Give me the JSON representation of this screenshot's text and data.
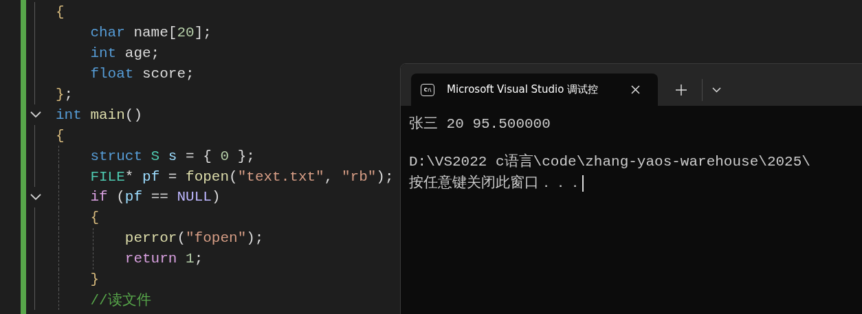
{
  "editor": {
    "lines": [
      {
        "foldable": false,
        "tokens": [
          {
            "t": "{",
            "kind": "brace"
          }
        ],
        "children": [
          {
            "foldable": false,
            "tokens": [
              {
                "t": "char",
                "kind": "keyword"
              },
              {
                "t": " name[",
                "kind": "plain"
              },
              {
                "t": "20",
                "kind": "number"
              },
              {
                "t": "];",
                "kind": "plain"
              }
            ]
          },
          {
            "foldable": false,
            "tokens": [
              {
                "t": "int",
                "kind": "keyword"
              },
              {
                "t": " age;",
                "kind": "plain"
              }
            ]
          },
          {
            "foldable": false,
            "tokens": [
              {
                "t": "float",
                "kind": "keyword"
              },
              {
                "t": " score;",
                "kind": "plain"
              }
            ]
          }
        ]
      },
      {
        "foldable": false,
        "tokens": [
          {
            "t": "}",
            "kind": "brace"
          },
          {
            "t": ";",
            "kind": "plain"
          }
        ]
      },
      {
        "foldable": true,
        "tokens": [
          {
            "t": "int",
            "kind": "keyword"
          },
          {
            "t": " main",
            "kind": "function"
          },
          {
            "t": "()",
            "kind": "plain"
          }
        ]
      },
      {
        "foldable": false,
        "tokens": [
          {
            "t": "{",
            "kind": "brace"
          }
        ],
        "children": [
          {
            "foldable": false,
            "tokens": [
              {
                "t": "struct",
                "kind": "keyword"
              },
              {
                "t": " S",
                "kind": "type"
              },
              {
                "t": " s",
                "kind": "variable"
              },
              {
                "t": " = { ",
                "kind": "plain"
              },
              {
                "t": "0",
                "kind": "number"
              },
              {
                "t": " };",
                "kind": "plain"
              }
            ]
          },
          {
            "foldable": false,
            "tokens": [
              {
                "t": "FILE",
                "kind": "type"
              },
              {
                "t": "* ",
                "kind": "plain"
              },
              {
                "t": "pf",
                "kind": "variable"
              },
              {
                "t": " = ",
                "kind": "plain"
              },
              {
                "t": "fopen",
                "kind": "function"
              },
              {
                "t": "(",
                "kind": "plain"
              },
              {
                "t": "\"text.txt\"",
                "kind": "string"
              },
              {
                "t": ", ",
                "kind": "plain"
              },
              {
                "t": "\"rb\"",
                "kind": "string"
              },
              {
                "t": ");",
                "kind": "plain"
              }
            ]
          },
          {
            "foldable": true,
            "tokens": [
              {
                "t": "if",
                "kind": "control"
              },
              {
                "t": " (",
                "kind": "plain"
              },
              {
                "t": "pf",
                "kind": "variable"
              },
              {
                "t": " == ",
                "kind": "plain"
              },
              {
                "t": "NULL",
                "kind": "macro"
              },
              {
                "t": ")",
                "kind": "plain"
              }
            ]
          },
          {
            "foldable": false,
            "tokens": [
              {
                "t": "{",
                "kind": "brace"
              }
            ],
            "children": [
              {
                "foldable": false,
                "tokens": [
                  {
                    "t": "perror",
                    "kind": "function"
                  },
                  {
                    "t": "(",
                    "kind": "plain"
                  },
                  {
                    "t": "\"fopen\"",
                    "kind": "string"
                  },
                  {
                    "t": ");",
                    "kind": "plain"
                  }
                ]
              },
              {
                "foldable": false,
                "tokens": [
                  {
                    "t": "return",
                    "kind": "control"
                  },
                  {
                    "t": " 1",
                    "kind": "number"
                  },
                  {
                    "t": ";",
                    "kind": "plain"
                  }
                ]
              }
            ]
          },
          {
            "foldable": false,
            "tokens": [
              {
                "t": "}",
                "kind": "brace"
              }
            ]
          },
          {
            "foldable": false,
            "tokens": [
              {
                "t": "//读文件",
                "kind": "comment"
              }
            ]
          }
        ]
      }
    ]
  },
  "terminal": {
    "tab": {
      "icon_text": "C:\\",
      "title": "Microsoft Visual Studio 调试控",
      "selected": true
    },
    "output": [
      {
        "lines": [
          "张三 20 95.500000"
        ]
      },
      {
        "lines": [
          "D:\\VS2022 c语言\\code\\zhang-yaos-warehouse\\2025\\",
          "按任意键关闭此窗口．．．"
        ]
      }
    ]
  }
}
